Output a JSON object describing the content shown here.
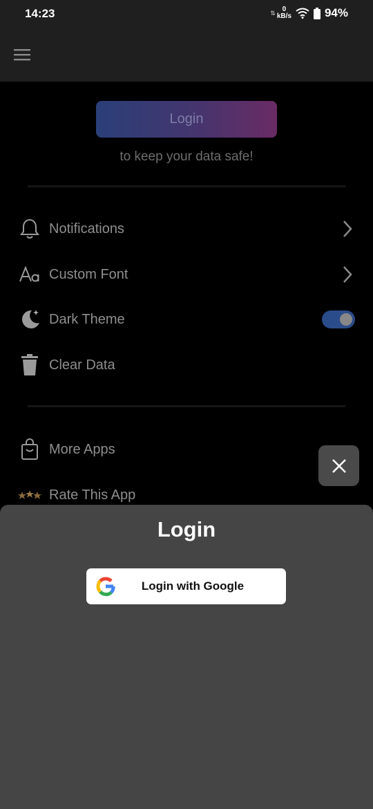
{
  "status_bar": {
    "time": "14:23",
    "net_speed_value": "0",
    "net_speed_unit": "kB/s",
    "battery": "94%"
  },
  "main": {
    "login_button": "Login",
    "tagline": "to keep your data safe!",
    "settings": [
      {
        "label": "Notifications",
        "icon": "bell-icon",
        "control": "chevron"
      },
      {
        "label": "Custom Font",
        "icon": "font-icon",
        "control": "chevron"
      },
      {
        "label": "Dark Theme",
        "icon": "moon-icon",
        "control": "toggle",
        "enabled": true
      },
      {
        "label": "Clear Data",
        "icon": "trash-icon",
        "control": "none"
      }
    ],
    "more": [
      {
        "label": "More Apps",
        "icon": "shopping-bag-icon"
      },
      {
        "label": "Rate This App",
        "icon": "stars-icon"
      }
    ]
  },
  "sheet": {
    "title": "Login",
    "google_button": "Login with Google"
  },
  "colors": {
    "accent_toggle": "#2b4c8a",
    "sheet_bg": "#454545",
    "appbar_bg": "#1f1f1f"
  }
}
